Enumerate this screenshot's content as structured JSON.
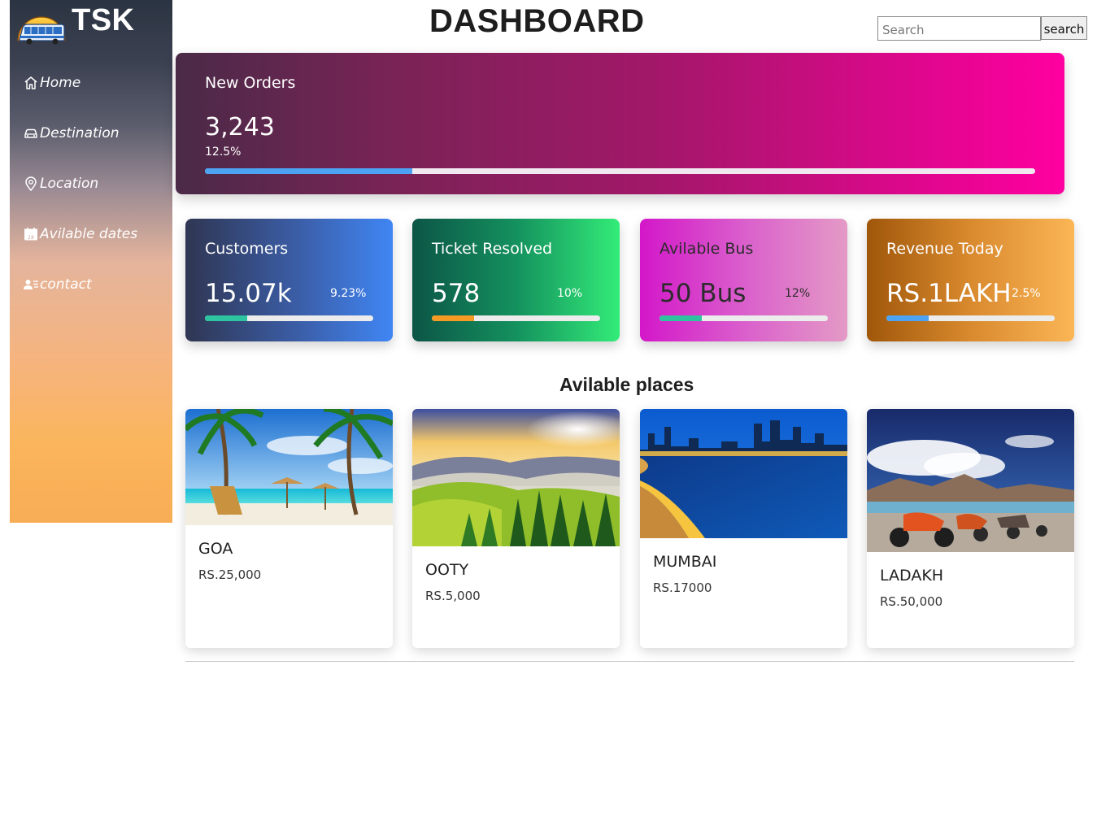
{
  "brand": {
    "name": "TSK",
    "logo_icon": "bus-sunset-logo"
  },
  "header": {
    "title": "DASHBOARD",
    "search_placeholder": "Search",
    "search_button": "search"
  },
  "sidebar": {
    "items": [
      {
        "label": "Home",
        "icon": "home-icon"
      },
      {
        "label": "Destination",
        "icon": "car-icon"
      },
      {
        "label": "Location",
        "icon": "location-pin-icon"
      },
      {
        "label": "Avilable dates",
        "icon": "calendar-icon"
      },
      {
        "label": "contact",
        "icon": "contact-icon"
      }
    ]
  },
  "hero": {
    "label": "New Orders",
    "value": "3,243",
    "percent": "12.5%",
    "progress": 0.25
  },
  "stats": [
    {
      "label": "Customers",
      "value": "15.07k",
      "percent": "9.23%",
      "progress": 0.25,
      "bar_color": "#2ec4a0"
    },
    {
      "label": "Ticket Resolved",
      "value": "578",
      "percent": "10%",
      "progress": 0.25,
      "bar_color": "#f59a23"
    },
    {
      "label": "Avilable Bus",
      "value": "50 Bus",
      "percent": "12%",
      "progress": 0.25,
      "bar_color": "#2ec4a0"
    },
    {
      "label": "Revenue Today",
      "value": "RS.1LAKH",
      "percent": "2.5%",
      "progress": 0.25,
      "bar_color": "#4da3f3"
    }
  ],
  "places": {
    "title": "Avilable places",
    "items": [
      {
        "name": "GOA",
        "price": "RS.25,000"
      },
      {
        "name": "OOTY",
        "price": "RS.5,000"
      },
      {
        "name": "MUMBAI",
        "price": "RS.17000"
      },
      {
        "name": "LADAKH",
        "price": "RS.50,000"
      }
    ]
  }
}
